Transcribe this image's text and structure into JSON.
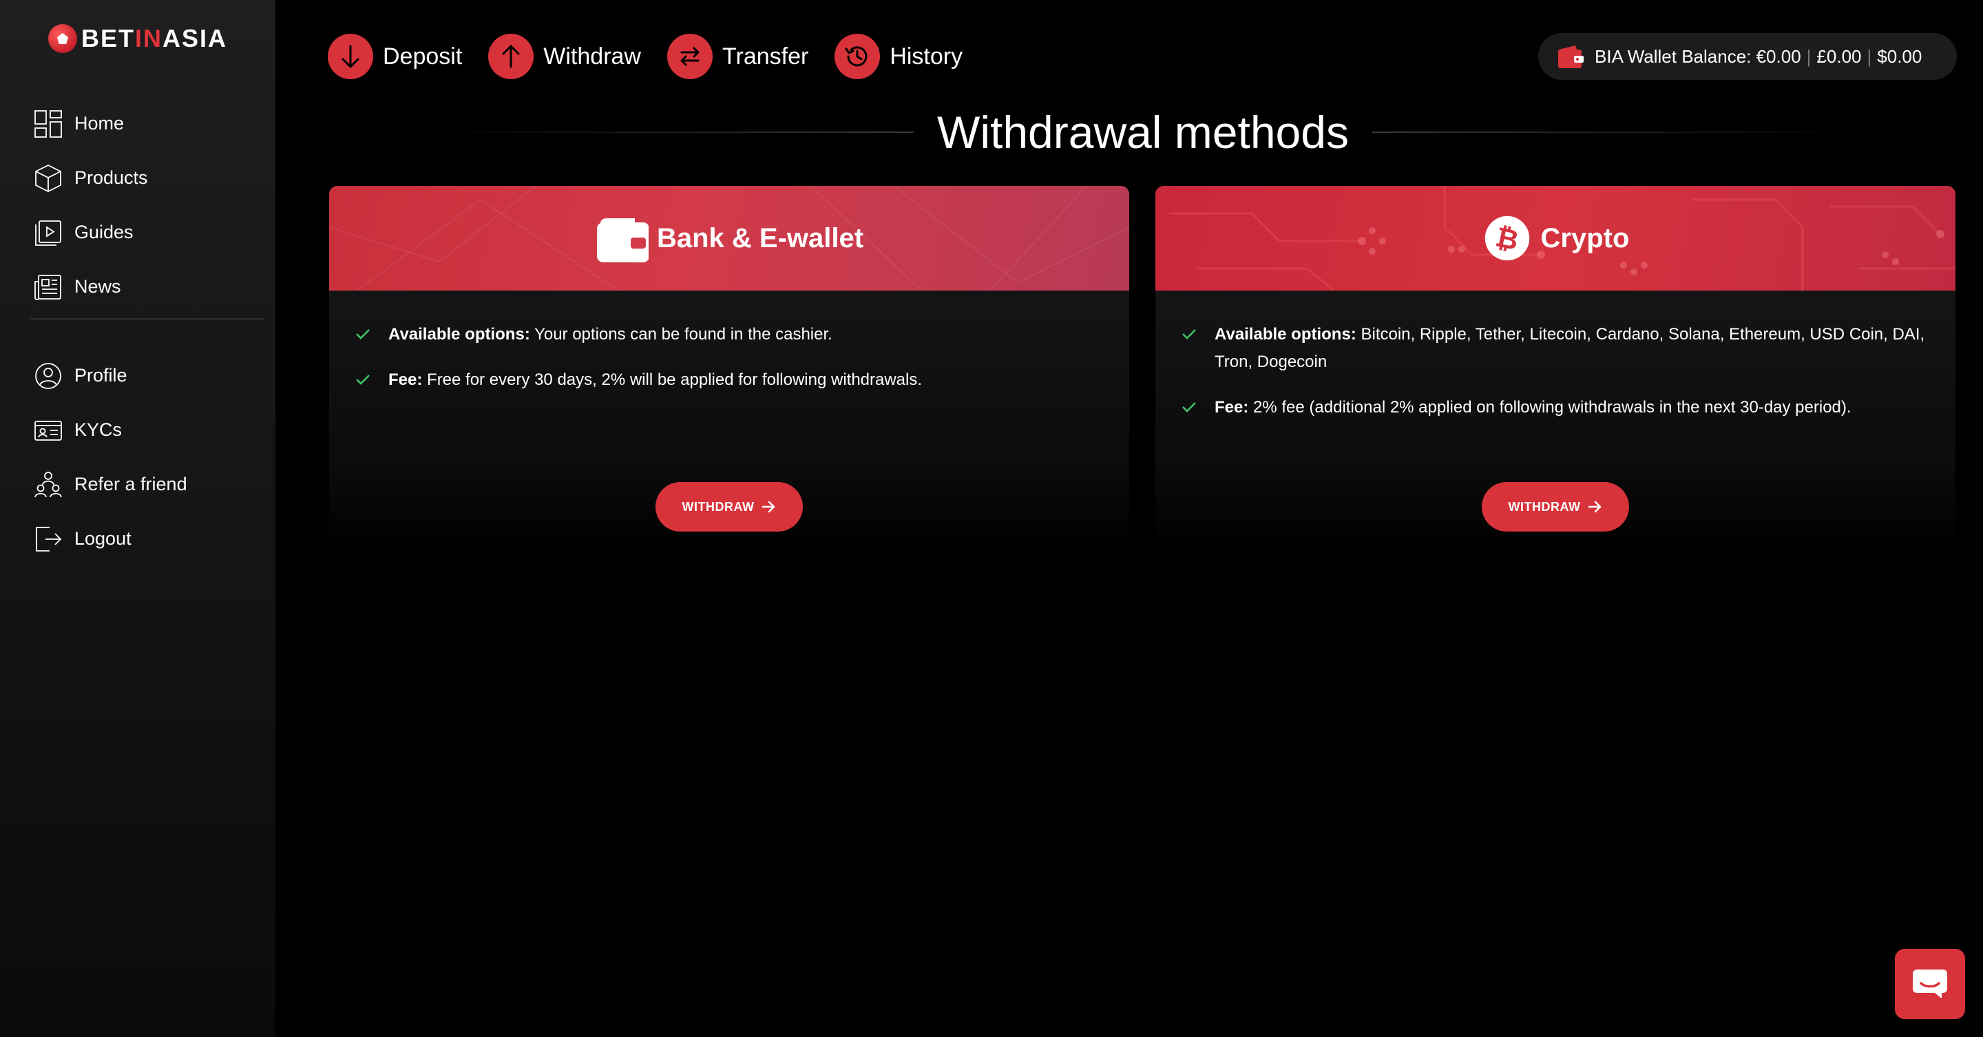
{
  "brand": {
    "part1": "BET",
    "part2": "IN",
    "part3": "ASIA"
  },
  "sidebar": {
    "primary": [
      {
        "label": "Home",
        "icon": "home-grid-icon"
      },
      {
        "label": "Products",
        "icon": "cube-icon"
      },
      {
        "label": "Guides",
        "icon": "video-guide-icon"
      },
      {
        "label": "News",
        "icon": "newspaper-icon"
      }
    ],
    "secondary": [
      {
        "label": "Profile",
        "icon": "user-circle-icon"
      },
      {
        "label": "KYCs",
        "icon": "id-card-icon"
      },
      {
        "label": "Refer a friend",
        "icon": "people-icon"
      },
      {
        "label": "Logout",
        "icon": "logout-icon"
      }
    ]
  },
  "topbar": {
    "deposit": "Deposit",
    "withdraw": "Withdraw",
    "transfer": "Transfer",
    "history": "History",
    "wallet_label": "BIA Wallet Balance: €0.00",
    "wallet_gbp": "£0.00",
    "wallet_usd": "$0.00"
  },
  "page": {
    "title": "Withdrawal methods"
  },
  "cards": {
    "bank": {
      "title": "Bank & E-wallet",
      "options_label": "Available options:",
      "options_text": " Your options can be found in the cashier.",
      "fee_label": "Fee:",
      "fee_text": " Free for every 30 days, 2% will be applied for following withdrawals.",
      "button": "WITHDRAW"
    },
    "crypto": {
      "title": "Crypto",
      "options_label": "Available options:",
      "options_text": " Bitcoin, Ripple, Tether, Litecoin, Cardano, Solana, Ethereum, USD Coin, DAI, Tron, Dogecoin",
      "fee_label": "Fee:",
      "fee_text": " 2% fee (additional 2% applied on following withdrawals in the next 30-day period).",
      "button": "WITHDRAW"
    }
  },
  "colors": {
    "accent": "#d8323a",
    "check": "#3fc46a",
    "sidebar": "#1a1a1a"
  }
}
